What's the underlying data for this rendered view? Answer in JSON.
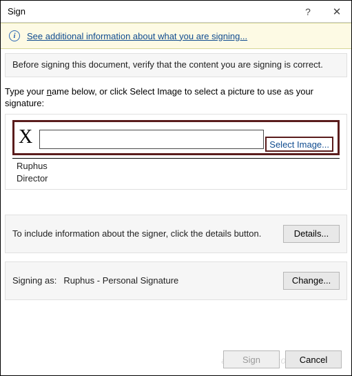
{
  "titlebar": {
    "title": "Sign",
    "help": "?",
    "close": "✕"
  },
  "banner": {
    "info_glyph": "i",
    "link_text": "See additional information about what you are signing..."
  },
  "verify": {
    "text": "Before signing this document, verify that the content you are signing is correct."
  },
  "prompt": {
    "prefix": "Type your ",
    "accesskey": "n",
    "suffix": "ame below, or click Select Image to select a picture to use as your signature:"
  },
  "signature": {
    "x_marker": "X",
    "input_value": "",
    "select_image_label": "Select Image...",
    "signer_name": "Ruphus",
    "signer_title": "Director"
  },
  "details_section": {
    "text": "To include information about the signer, click the details button.",
    "button_label": "Details..."
  },
  "signing_as": {
    "label": "Signing as:",
    "value": "Ruphus - Personal Signature",
    "change_label": "Change..."
  },
  "footer": {
    "sign_label": "Sign",
    "cancel_label": "Cancel"
  },
  "watermark": "admindroid.com"
}
